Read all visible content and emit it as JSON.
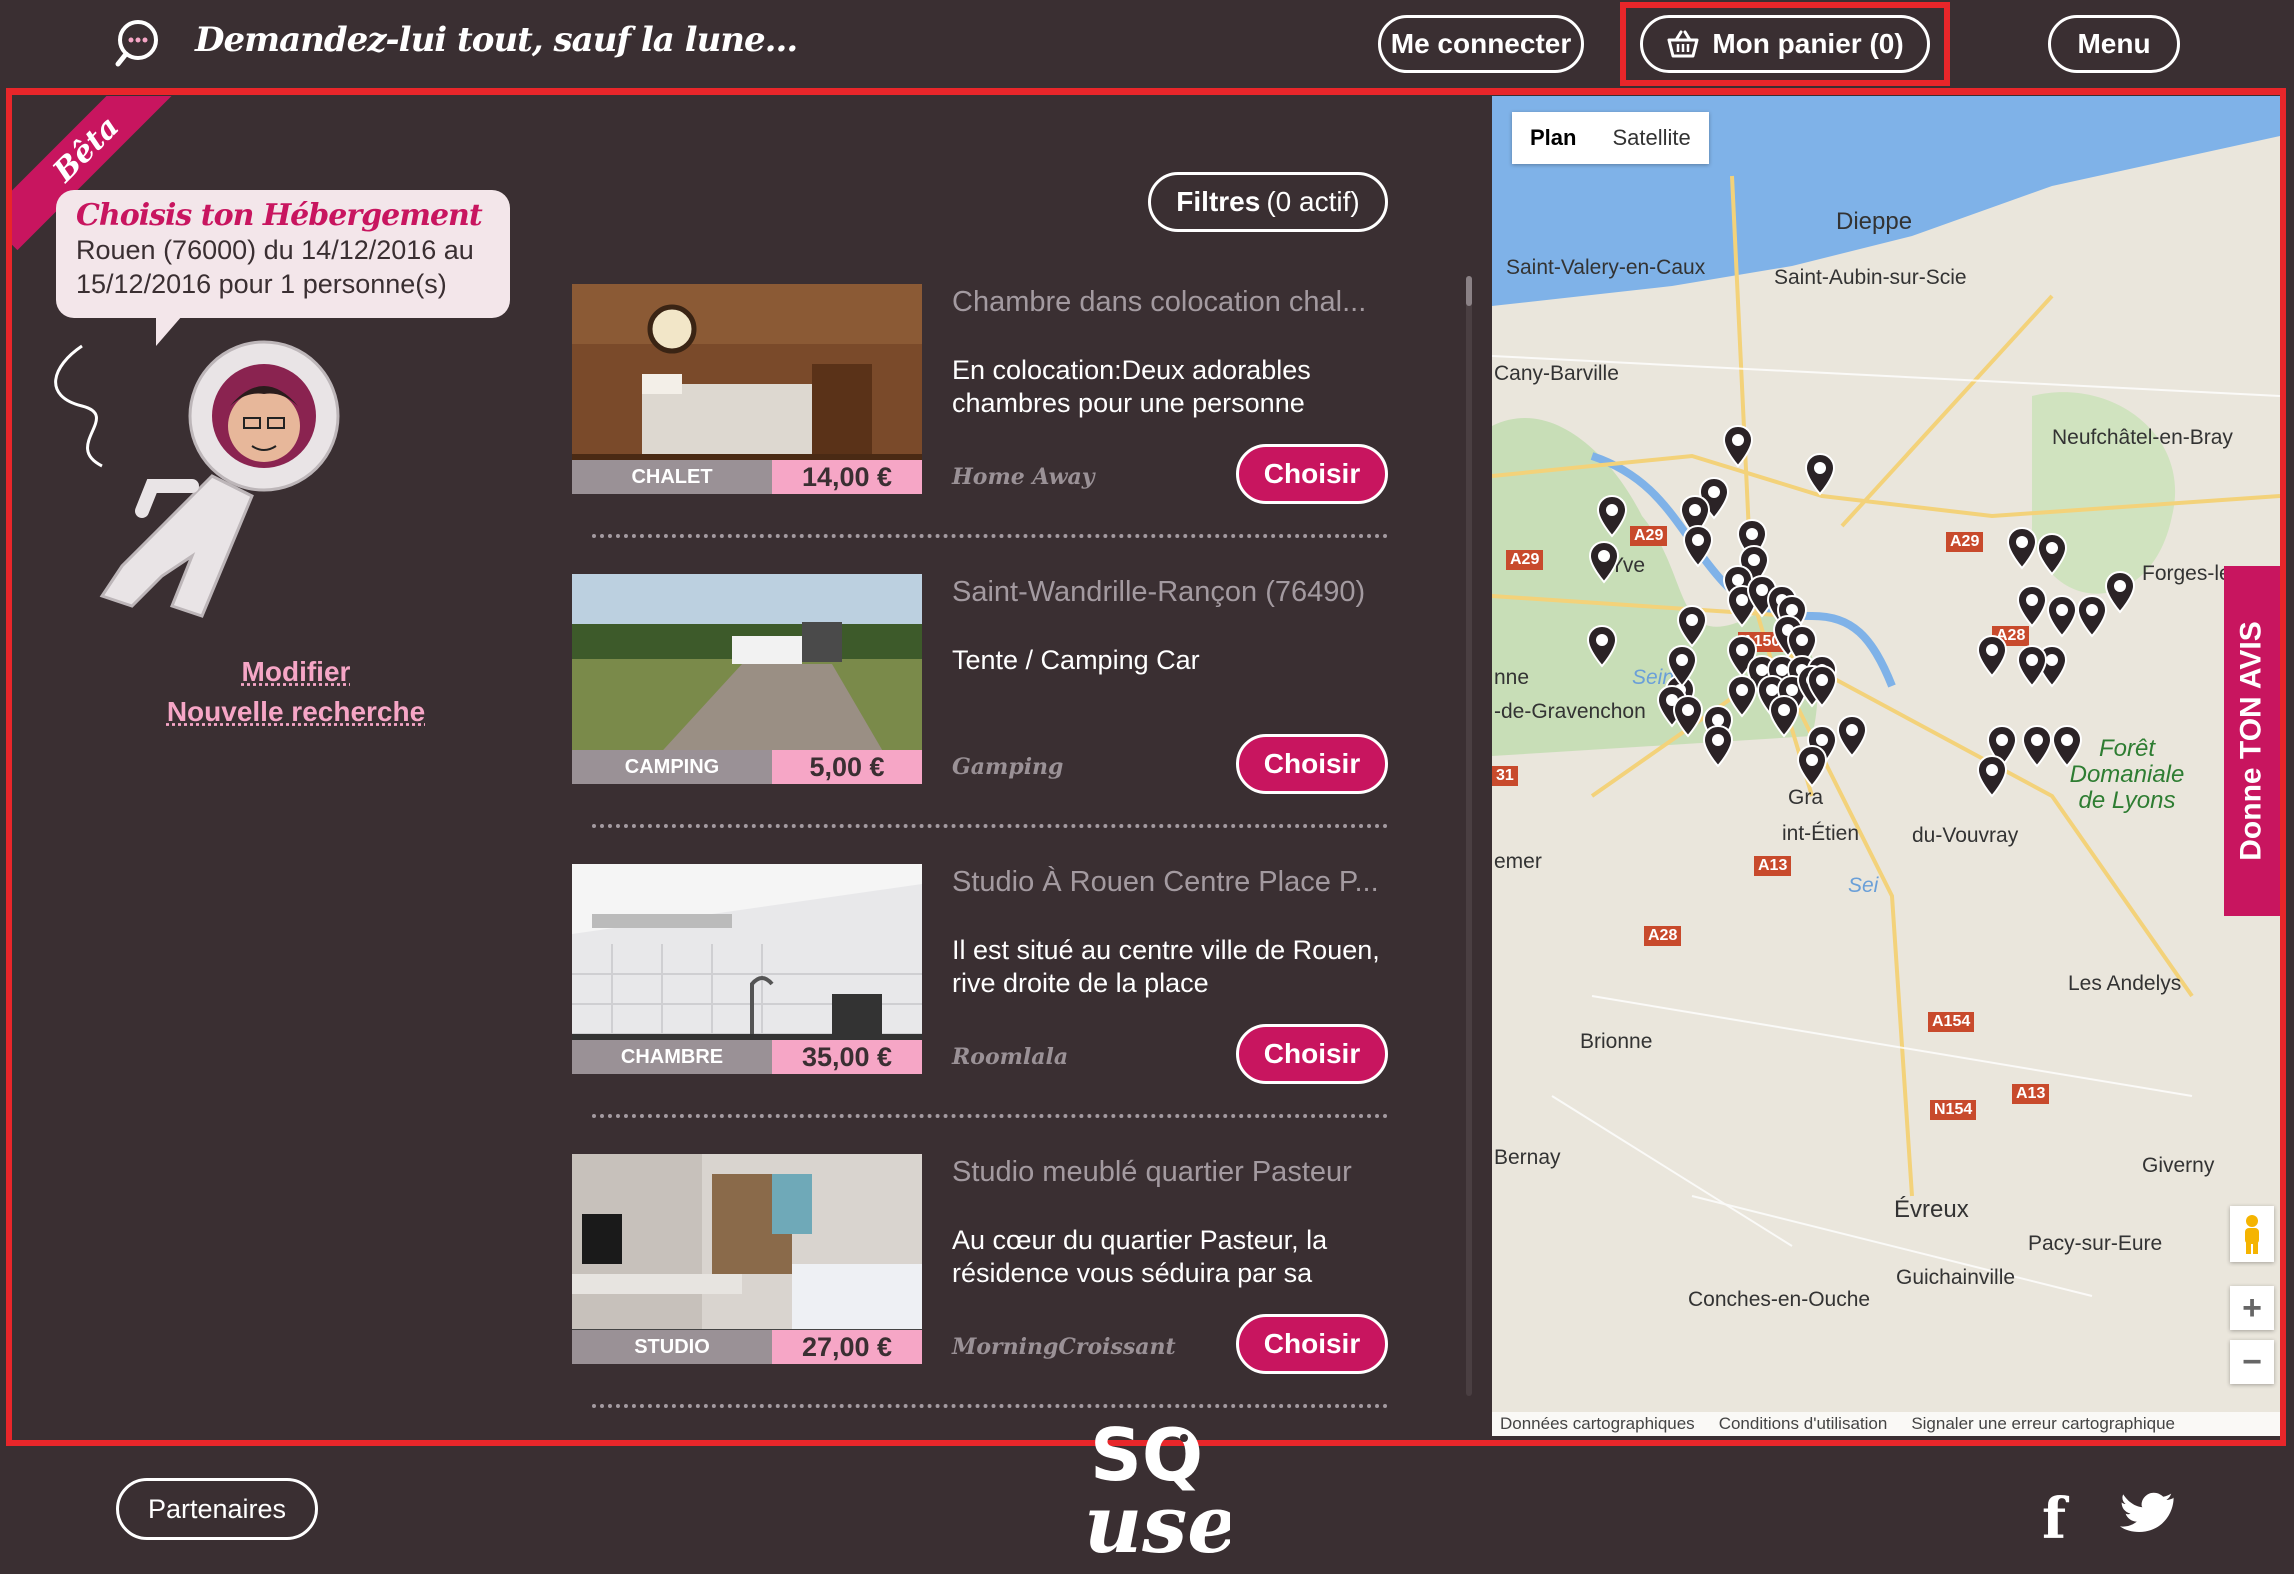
{
  "header": {
    "tagline": "Demandez-lui tout, sauf la lune...",
    "login_label": "Me connecter",
    "cart_label": "Mon panier (0)",
    "menu_label": "Menu"
  },
  "sidebar": {
    "beta_label": "Bêta",
    "bubble_title": "Choisis ton Hébergement",
    "bubble_text": "Rouen (76000) du 14/12/2016 au 15/12/2016 pour 1 personne(s)",
    "modify_link": "Modifier",
    "new_search_link": "Nouvelle recherche"
  },
  "filters": {
    "label_bold": "Filtres",
    "label_count": "(0 actif)"
  },
  "listings": [
    {
      "title": "Chambre dans colocation chal...",
      "description": "En colocation:Deux adorables chambres pour une personne",
      "category": "CHALET",
      "price": "14,00 €",
      "source": "Home Away",
      "choose_label": "Choisir"
    },
    {
      "title": "Saint-Wandrille-Rançon (76490)",
      "description": "Tente / Camping Car",
      "category": "CAMPING",
      "price": "5,00 €",
      "source": "Gamping",
      "choose_label": "Choisir"
    },
    {
      "title": "Studio À Rouen Centre Place P...",
      "description": "Il est situé au centre ville de Rouen, rive droite de la place",
      "category": "CHAMBRE",
      "price": "35,00 €",
      "source": "Roomlala",
      "choose_label": "Choisir"
    },
    {
      "title": "Studio meublé quartier Pasteur",
      "description": "Au cœur du quartier Pasteur, la résidence vous séduira par sa",
      "category": "STUDIO",
      "price": "27,00 €",
      "source": "MorningCroissant",
      "choose_label": "Choisir"
    }
  ],
  "map": {
    "type_plan": "Plan",
    "type_satellite": "Satellite",
    "feedback_tab": "Donne TON AVIS",
    "zoom_in": "+",
    "zoom_out": "−",
    "footer_data": "Données cartographiques",
    "footer_terms": "Conditions d'utilisation",
    "footer_report": "Signaler une erreur cartographique",
    "places": {
      "dieppe": "Dieppe",
      "saint_valery": "Saint-Valery-en-Caux",
      "saint_aubin": "Saint-Aubin-sur-Scie",
      "cany": "Cany-Barville",
      "neufchatel": "Neufchâtel-en-Bray",
      "forges": "Forges-le",
      "yvetot": "Yve",
      "seine": "Seine",
      "bonne": "nne",
      "gravenchon": "-de-Gravenchon",
      "foret": "Forêt Domaniale de Lyons",
      "gra": "Gra",
      "st_etienne": "int-Étien",
      "du_vray": "du-Vouvray",
      "emer": "emer",
      "seine2": "Sei",
      "les_andelys": "Les Andelys",
      "brionne": "Brionne",
      "bernay": "Bernay",
      "giverny": "Giverny",
      "evreux": "Évreux",
      "pacy": "Pacy-sur-Eure",
      "guichainville": "Guichainville",
      "conches": "Conches-en-Ouche"
    },
    "roads": [
      "A29",
      "A29",
      "A29",
      "A150",
      "A28",
      "A13",
      "A28",
      "A154",
      "A13",
      "N154",
      "31"
    ]
  },
  "footer": {
    "partners_label": "Partenaires",
    "logo_text_top": "SQ",
    "logo_text_bottom": "use"
  },
  "colors": {
    "background": "#3a2f32",
    "accent": "#c8155f",
    "pink_light": "#f6a6c6",
    "highlight_border": "#e8262a"
  }
}
